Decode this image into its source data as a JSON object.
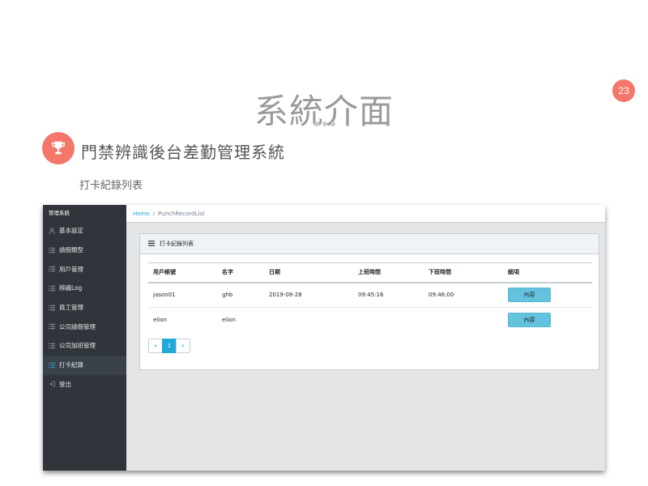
{
  "slide": {
    "title": "系統介面",
    "page_number": "23",
    "system_name": "門禁辨識後台差勤管理系統",
    "section_label": "打卡紀錄列表",
    "accent_color": "#f4776a"
  },
  "sidebar": {
    "brand": "管理系統",
    "items": [
      {
        "label": "基本設定",
        "icon": "user-icon"
      },
      {
        "label": "請假類型",
        "icon": "list-icon"
      },
      {
        "label": "用戶管理",
        "icon": "list-icon"
      },
      {
        "label": "辨識Log",
        "icon": "list-icon"
      },
      {
        "label": "員工管理",
        "icon": "list-icon"
      },
      {
        "label": "公司請假管理",
        "icon": "list-icon"
      },
      {
        "label": "公司加班管理",
        "icon": "list-icon"
      },
      {
        "label": "打卡紀錄",
        "icon": "list-icon",
        "active": true
      },
      {
        "label": "登出",
        "icon": "logout-icon"
      }
    ]
  },
  "breadcrumb": {
    "home": "Home",
    "separator": "/",
    "current": "PunchRecordList"
  },
  "card": {
    "title": "打卡紀錄列表",
    "columns": [
      "用戶帳號",
      "名字",
      "日期",
      "上班時間",
      "下班時間",
      "細項"
    ],
    "rows": [
      {
        "account": "jason01",
        "name": "ghb",
        "date": "2019-08-28",
        "in_time": "09:45:16",
        "out_time": "09:46:00",
        "action": "內容"
      },
      {
        "account": "elion",
        "name": "elion",
        "date": "",
        "in_time": "",
        "out_time": "",
        "action": "內容"
      }
    ]
  },
  "pagination": {
    "prev": "«",
    "current": "1",
    "next": "»"
  }
}
